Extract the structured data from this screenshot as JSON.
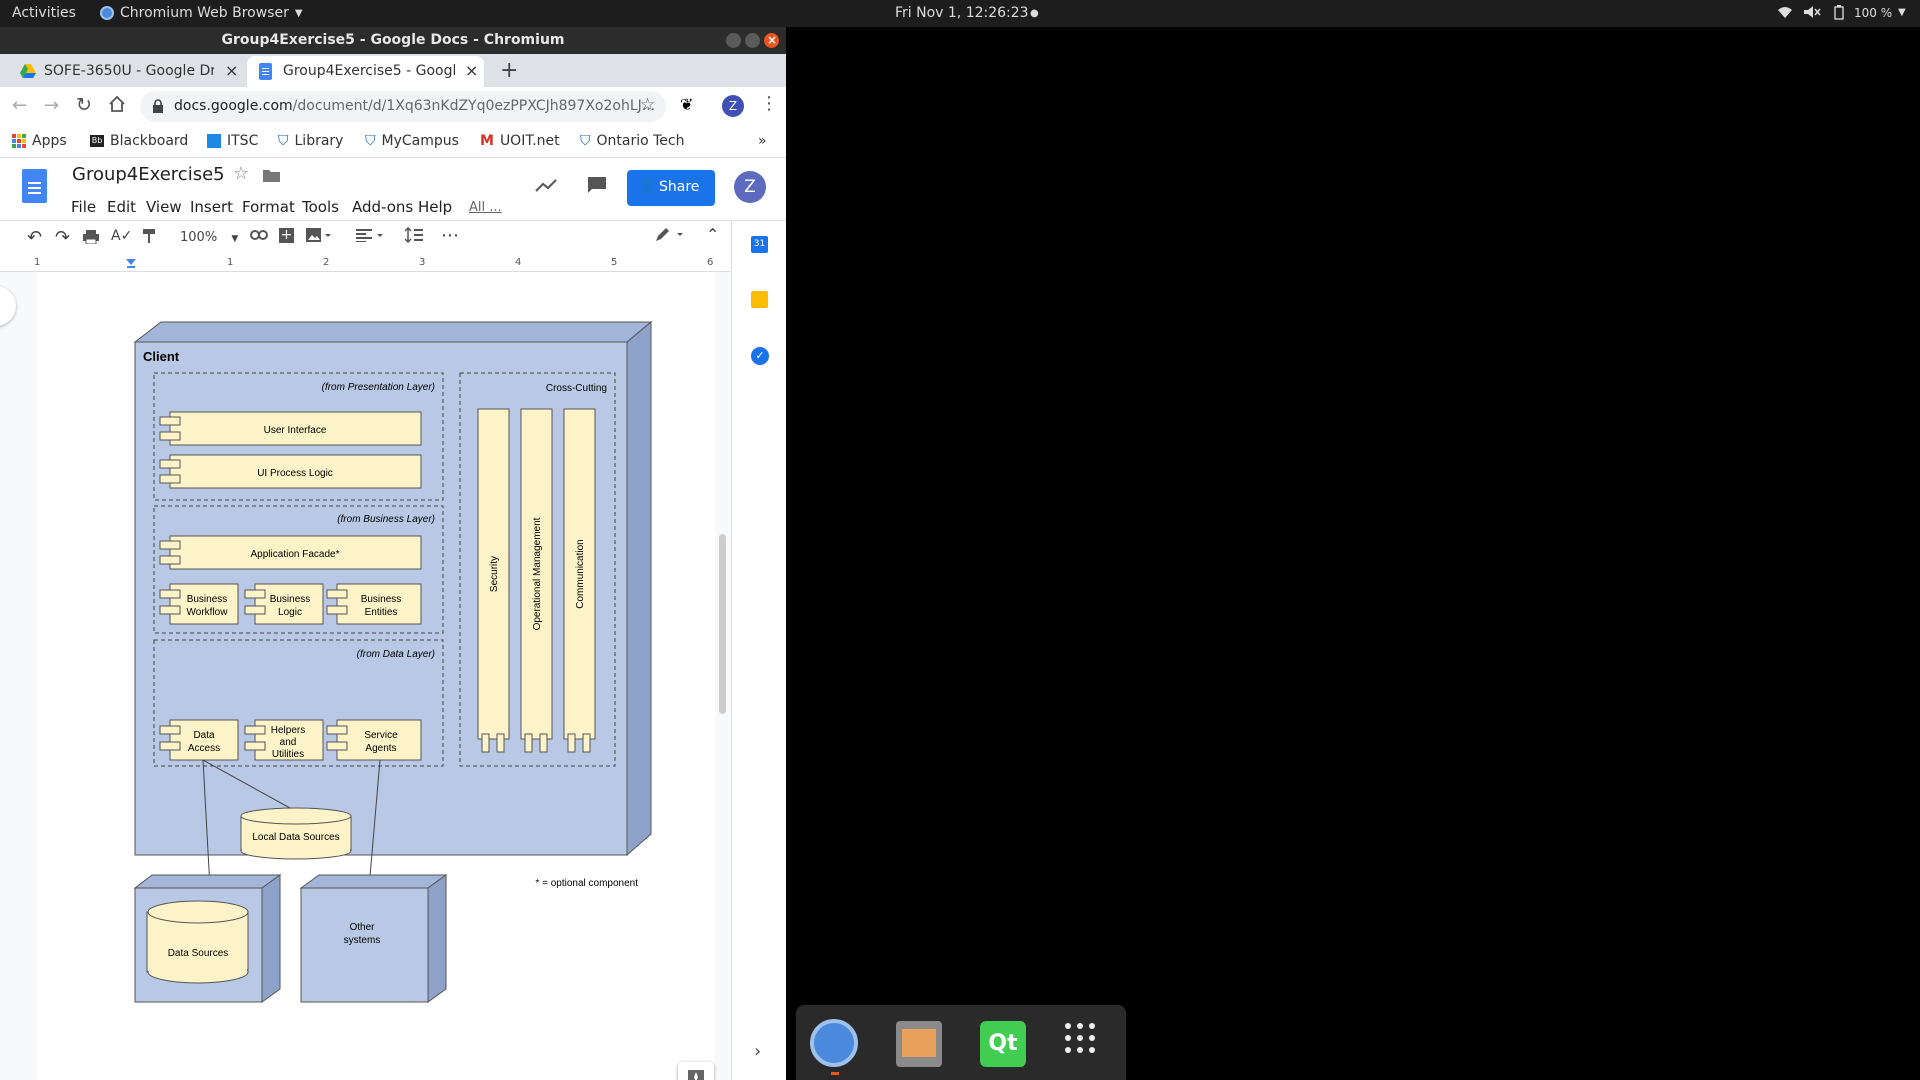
{
  "topbar": {
    "activities": "Activities",
    "app_menu": "Chromium Web Browser",
    "clock": "Fri Nov  1, 12:26:23",
    "battery": "100 %"
  },
  "window": {
    "title": "Group4Exercise5 - Google Docs - Chromium"
  },
  "tabs": [
    {
      "label": "SOFE-3650U - Google Driv",
      "active": false
    },
    {
      "label": "Group4Exercise5 - Google",
      "active": true
    }
  ],
  "address": {
    "host": "docs.google.com",
    "path": "/document/d/1Xq63nKdZYq0ezPPXCJh897Xo2ohLJ..."
  },
  "profile_initial": "Z",
  "bookmarks": [
    "Apps",
    "Blackboard",
    "ITSC",
    "Library",
    "MyCampus",
    "UOIT.net",
    "Ontario Tech"
  ],
  "docs": {
    "title": "Group4Exercise5",
    "menus": [
      "File",
      "Edit",
      "View",
      "Insert",
      "Format",
      "Tools",
      "Add-ons",
      "Help",
      "All ..."
    ],
    "share_label": "Share",
    "zoom": "100%",
    "ruler_marks": [
      "1",
      "1",
      "2",
      "3",
      "4",
      "5",
      "6"
    ]
  },
  "diagram": {
    "client_label": "Client",
    "presentation_label": "(from Presentation Layer)",
    "user_interface": "User Interface",
    "ui_process_logic": "UI Process Logic",
    "business_label": "(from Business Layer)",
    "application_facade": "Application Facade*",
    "business_workflow": [
      "Business",
      "Workflow"
    ],
    "business_logic": [
      "Business",
      "Logic"
    ],
    "business_entities": [
      "Business",
      "Entities"
    ],
    "data_label": "(from Data Layer)",
    "data_access": [
      "Data",
      "Access"
    ],
    "helpers": [
      "Helpers",
      "and",
      "Utilities"
    ],
    "service_agents": [
      "Service",
      "Agents"
    ],
    "cross_cutting": "Cross-Cutting",
    "security": "Security",
    "operational_management": "Operational Management",
    "communication": "Communication",
    "local_data_sources": "Local Data Sources",
    "data_sources": "Data Sources",
    "other_systems": [
      "Other",
      "systems"
    ],
    "optional_note": "* = optional component"
  },
  "colors": {
    "diagram_blue": "#b9c8e4",
    "diagram_blue_dark": "#8ea2c9",
    "component_fill": "#fdf3c9",
    "share_blue": "#1a73e8",
    "avatar": "#5c6bc0"
  }
}
